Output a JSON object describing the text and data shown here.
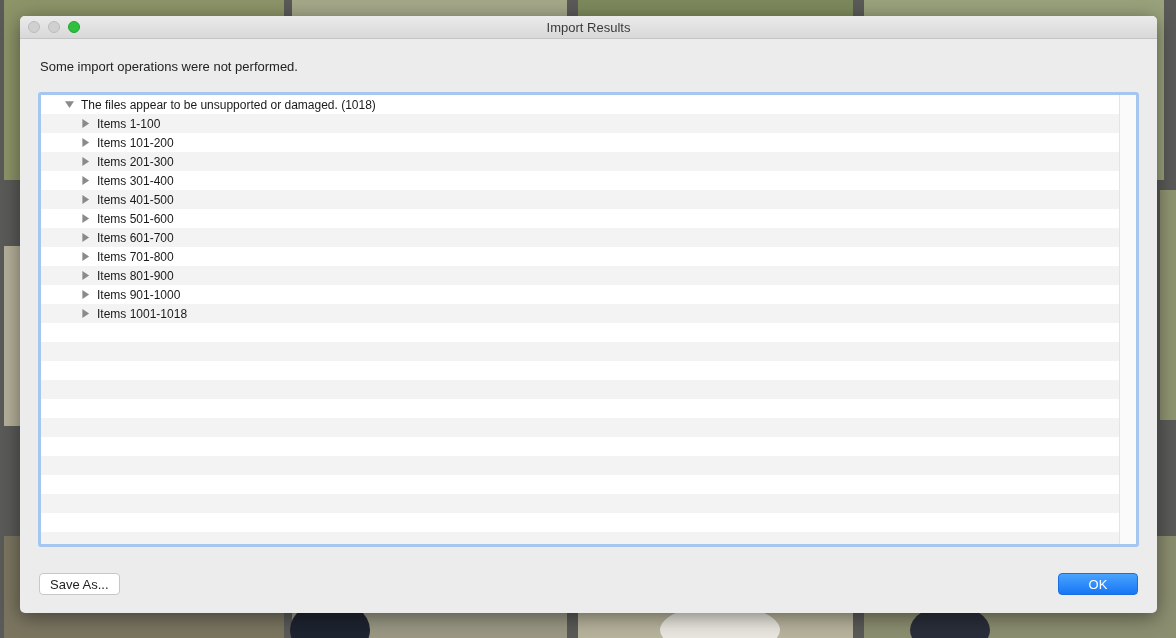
{
  "window": {
    "title": "Import Results"
  },
  "message": "Some import operations were not performed.",
  "tree": [
    {
      "label": "The files appear to be unsupported or damaged. (1018)",
      "expanded": true,
      "children": [
        {
          "label": "Items 1-100",
          "expanded": false
        },
        {
          "label": "Items 101-200",
          "expanded": false
        },
        {
          "label": "Items 201-300",
          "expanded": false
        },
        {
          "label": "Items 301-400",
          "expanded": false
        },
        {
          "label": "Items 401-500",
          "expanded": false
        },
        {
          "label": "Items 501-600",
          "expanded": false
        },
        {
          "label": "Items 601-700",
          "expanded": false
        },
        {
          "label": "Items 701-800",
          "expanded": false
        },
        {
          "label": "Items 801-900",
          "expanded": false
        },
        {
          "label": "Items 901-1000",
          "expanded": false
        },
        {
          "label": "Items 1001-1018",
          "expanded": false
        }
      ]
    }
  ],
  "buttons": [
    {
      "label": "Save As...",
      "kind": "secondary"
    },
    {
      "label": "OK",
      "kind": "default"
    }
  ]
}
